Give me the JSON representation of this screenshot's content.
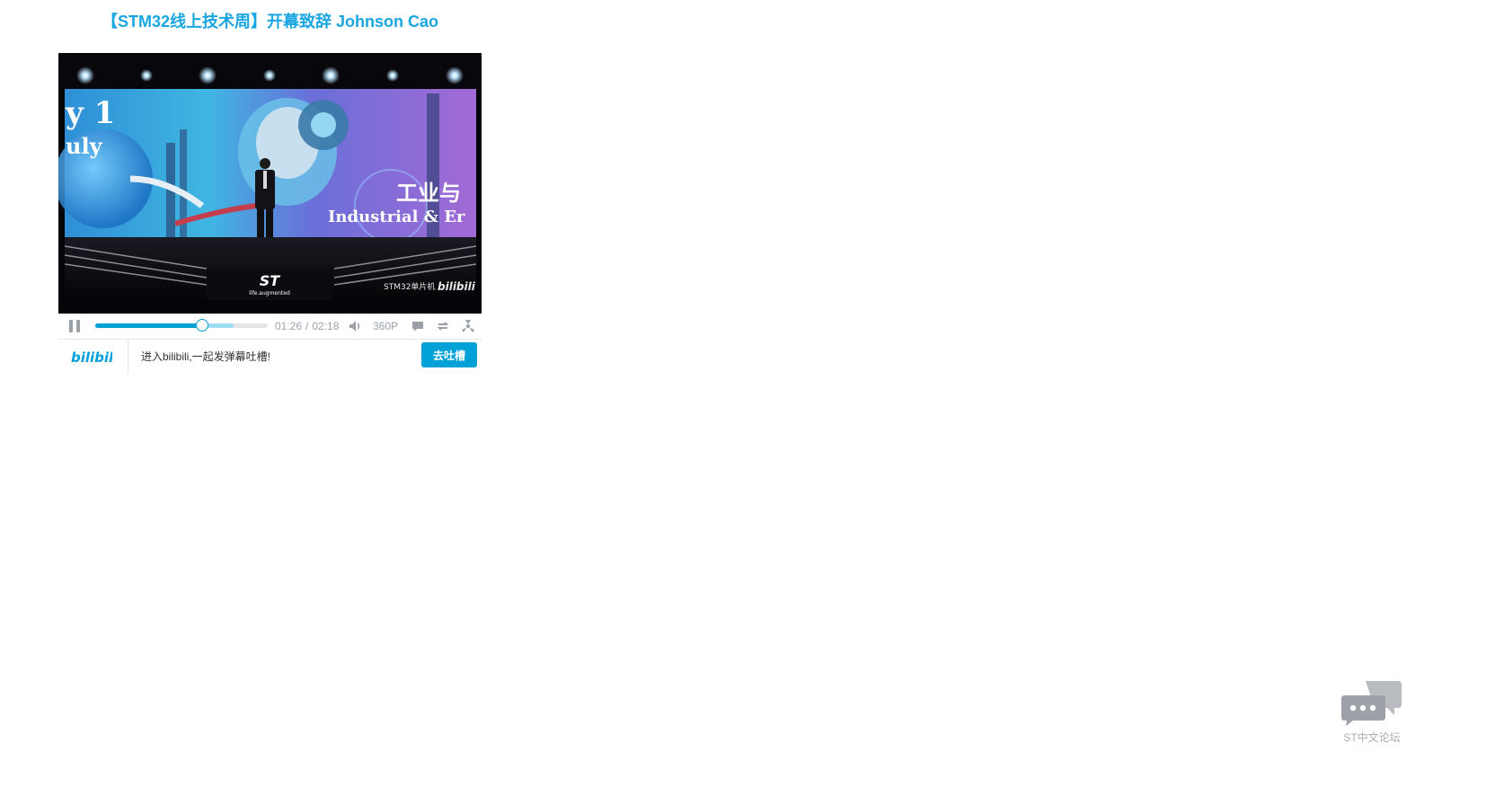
{
  "page": {
    "title": "【STM32线上技术周】开幕致辞 Johnson Cao"
  },
  "video": {
    "overlay_text": {
      "date_line1": "y 1",
      "date_line2": "uly",
      "banner_cn": "工业与",
      "banner_en": "Industrial & Er",
      "st_tagline": "life.augmented",
      "st_logo_text": "ST",
      "watermark_channel": "STM32单片机",
      "watermark_brand": "bilibili"
    }
  },
  "controls": {
    "current_time": "01:26",
    "separator": "/",
    "duration": "02:18",
    "played_fraction": 0.62,
    "buffered_fraction": 0.8,
    "quality": "360P",
    "icons": [
      "pause-icon",
      "volume-icon",
      "danmaku-icon",
      "loop-icon",
      "fan-icon"
    ]
  },
  "bottom_bar": {
    "logo_text": "bilibili",
    "prompt": "进入bilibili,一起发弹幕吐槽!",
    "button_label": "去吐槽"
  },
  "forum_widget": {
    "label": "ST中文论坛"
  },
  "colors": {
    "accent": "#00a1d6",
    "title": "#1aa6e0",
    "muted": "#99a2aa"
  }
}
